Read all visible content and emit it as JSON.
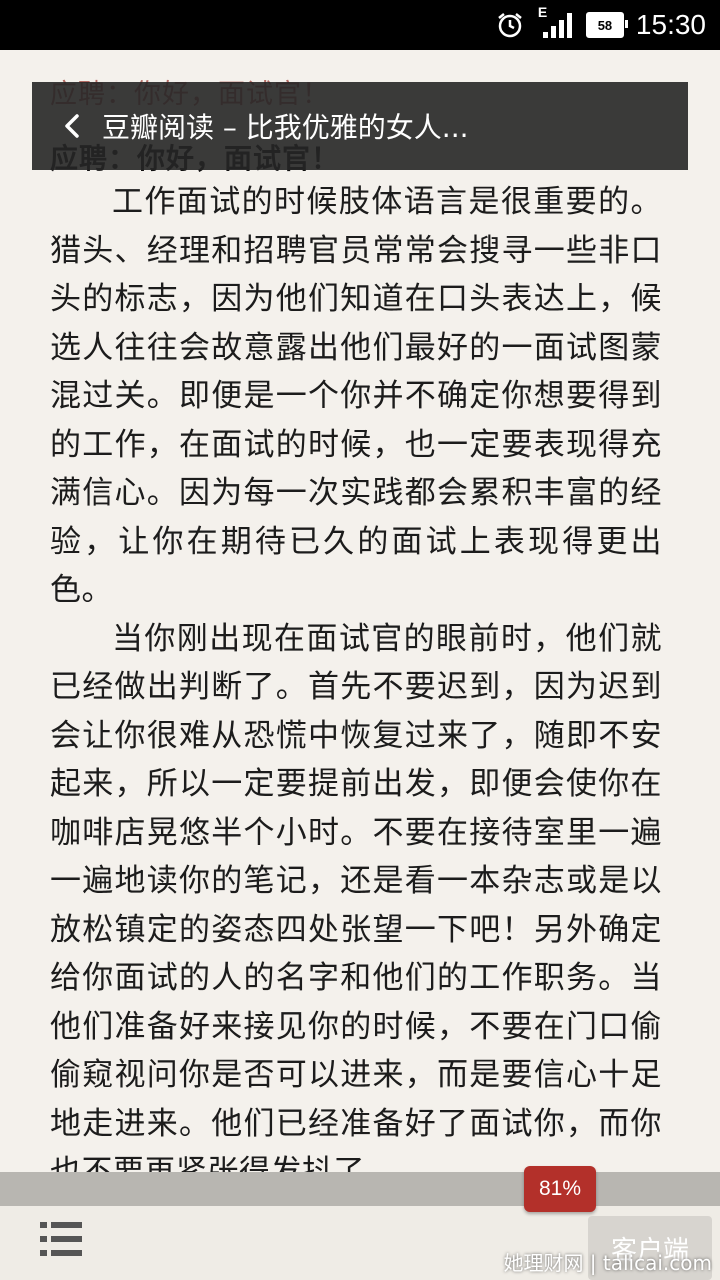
{
  "status_bar": {
    "network_type": "E",
    "battery_level": "58",
    "time": "15:30"
  },
  "app_bar": {
    "title": "豆瓣阅读 – 比我优雅的女人..."
  },
  "article": {
    "heading": "应聘：你好，面试官！",
    "paragraphs": [
      "工作面试的时候肢体语言是很重要的。猎头、经理和招聘官员常常会搜寻一些非口头的标志，因为他们知道在口头表达上，候选人往往会故意露出他们最好的一面试图蒙混过关。即便是一个你并不确定你想要得到的工作，在面试的时候，也一定要表现得充满信心。因为每一次实践都会累积丰富的经验，让你在期待已久的面试上表现得更出色。",
      "当你刚出现在面试官的眼前时，他们就已经做出判断了。首先不要迟到，因为迟到会让你很难从恐慌中恢复过来了，随即不安起来，所以一定要提前出发，即便会使你在咖啡店晃悠半个小时。不要在接待室里一遍一遍地读你的笔记，还是看一本杂志或是以放松镇定的姿态四处张望一下吧！另外确定给你面试的人的名字和他们的工作职务。当他们准备好来接见你的时候，不要在门口偷偷窥视问你是否可以进来，而是要信心十足地走进来。他们已经准备好了面试你，而你也不要再紧张得发抖了。"
    ]
  },
  "reader": {
    "progress_label": "81%",
    "progress": 0.81,
    "client_button": "客户端"
  },
  "watermark": "她理财网 | talicai.com",
  "icons": {
    "alarm": "alarm-clock-icon",
    "signal": "signal-icon",
    "battery": "battery-icon",
    "back": "back-chevron-icon",
    "menu": "list-menu-icon"
  },
  "colors": {
    "page_bg": "#f4f1ec",
    "progress_badge": "#b3302a",
    "app_bar_bg": "#262626"
  }
}
